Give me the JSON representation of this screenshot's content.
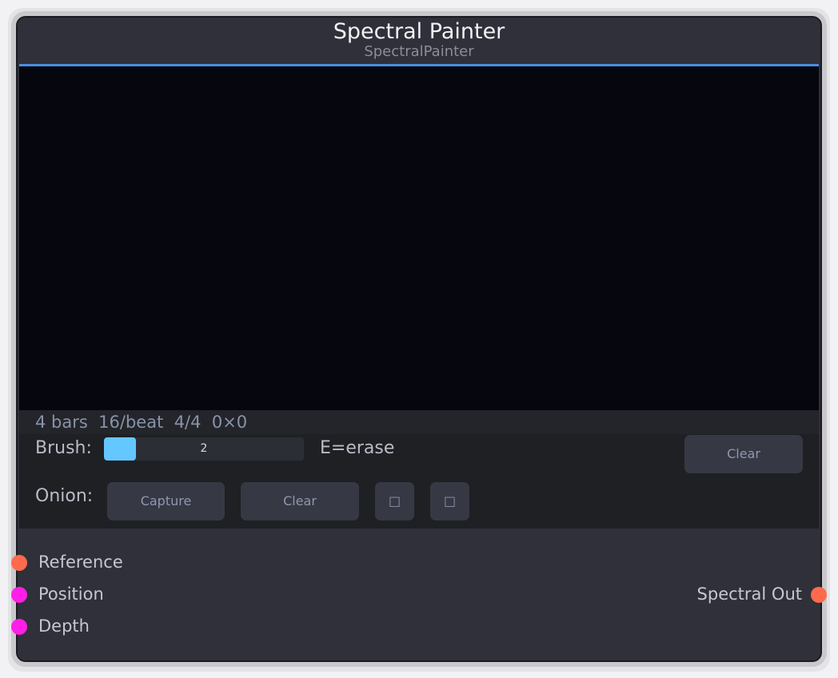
{
  "node": {
    "title": "Spectral Painter",
    "subtitle": "SpectralPainter"
  },
  "status": {
    "bars": "4 bars",
    "subdivision": "16/beat",
    "time_signature": "4/4",
    "dimensions": "0×0"
  },
  "brush": {
    "label": "Brush:",
    "value": "2",
    "level_fraction": 0.16,
    "erase_hint": "E=erase",
    "clear_label": "Clear"
  },
  "onion": {
    "label": "Onion:",
    "capture_label": "Capture",
    "clear_label": "Clear",
    "toggle1": "□",
    "toggle2": "□"
  },
  "ports": {
    "inputs": [
      {
        "label": "Reference",
        "color": "#ff6a4d"
      },
      {
        "label": "Position",
        "color": "#ff1ee6"
      },
      {
        "label": "Depth",
        "color": "#ff1ee6"
      }
    ],
    "outputs": [
      {
        "label": "Spectral Out",
        "color": "#ff6a4d"
      }
    ]
  },
  "colors": {
    "accent": "#4a90e2",
    "brush_fill": "#65c7ff",
    "canvas": "#05060e"
  }
}
